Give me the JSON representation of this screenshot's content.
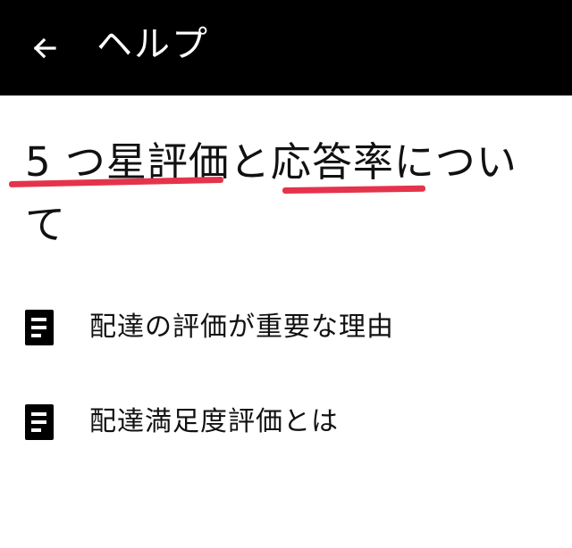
{
  "app_bar": {
    "back_icon": "arrow-left-icon",
    "title": "ヘルプ"
  },
  "main": {
    "title": "5 つ星評価と応答率について",
    "highlight_color": "#e5334c",
    "articles": [
      {
        "icon": "document-icon",
        "label": "配達の評価が重要な理由"
      },
      {
        "icon": "document-icon",
        "label": "配達満足度評価とは"
      }
    ]
  }
}
